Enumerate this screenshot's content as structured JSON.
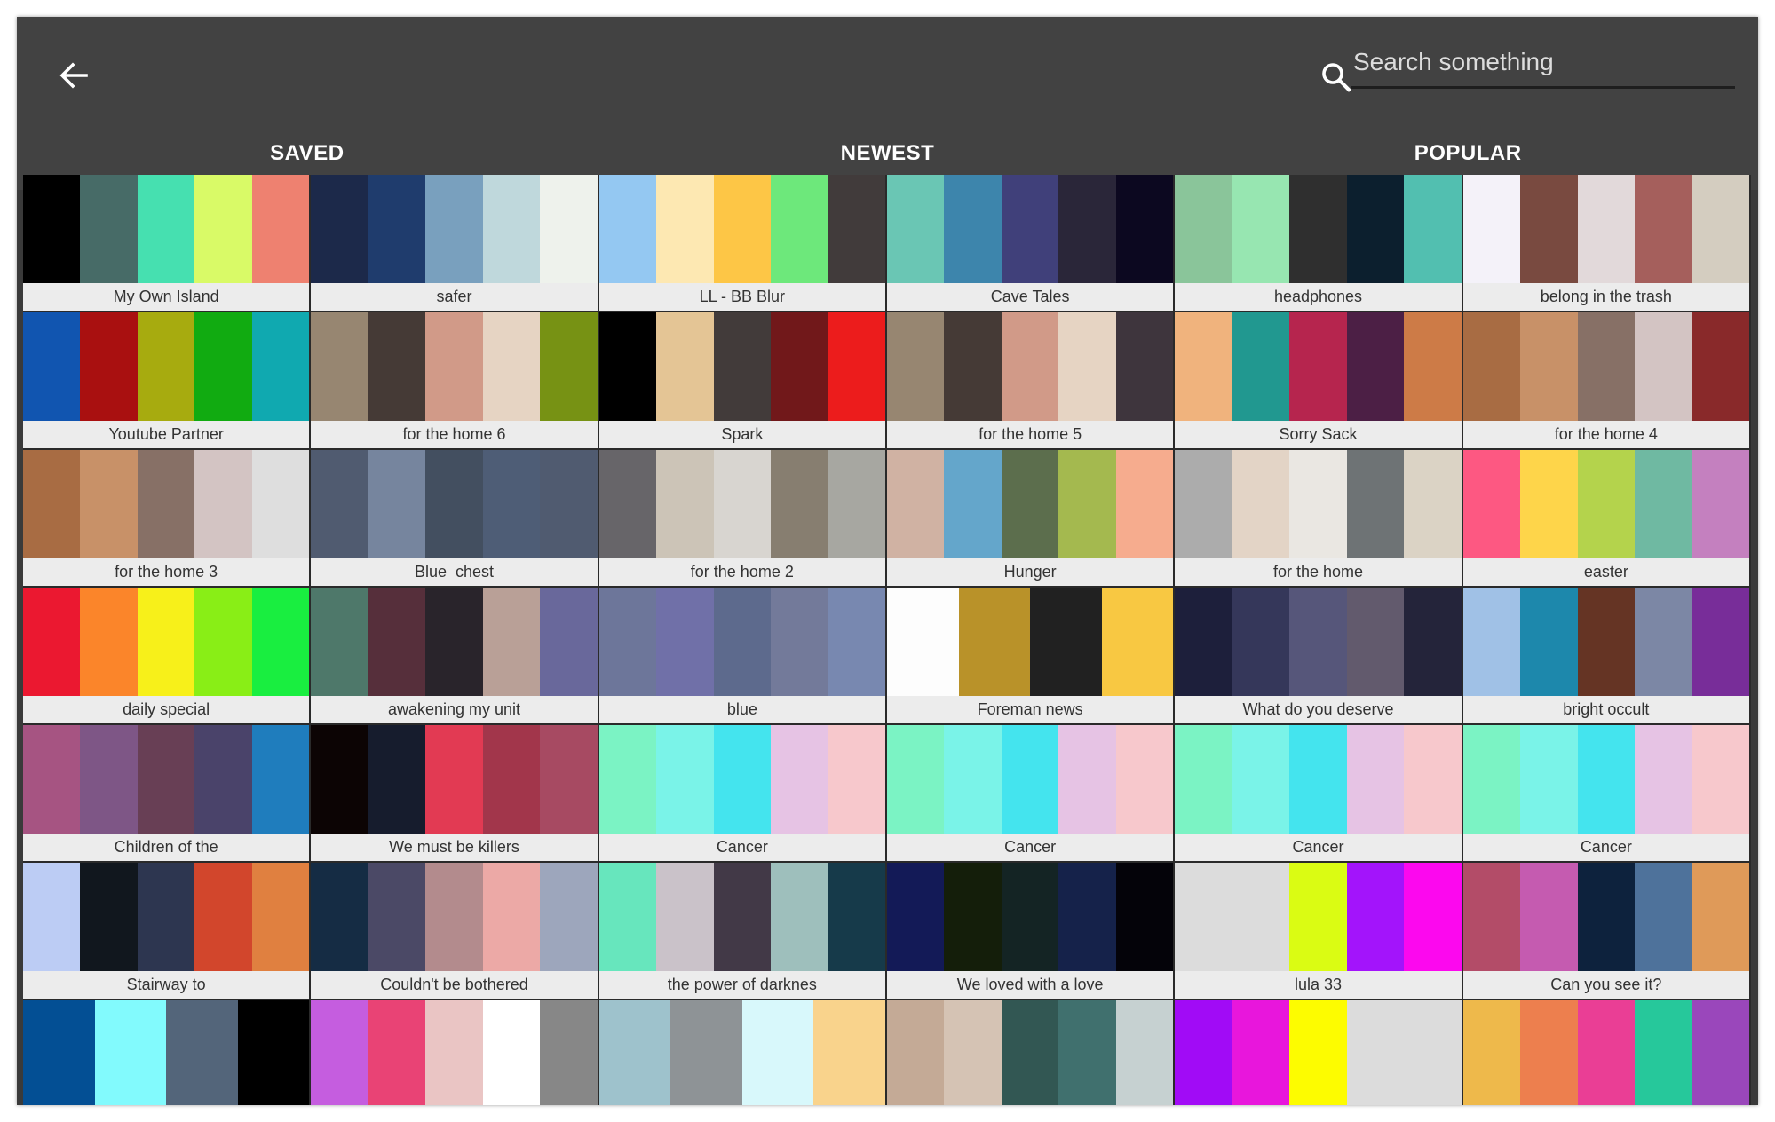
{
  "toolbar": {
    "search_placeholder": "Search something",
    "back_icon": "arrow-left-icon",
    "search_icon": "search-icon"
  },
  "tabs": [
    {
      "label": "SAVED",
      "active": false
    },
    {
      "label": "NEWEST",
      "active": true
    },
    {
      "label": "POPULAR",
      "active": false
    }
  ],
  "palettes": [
    {
      "name": "My Own Island",
      "colors": [
        "#000000",
        "#476b67",
        "#46e0b0",
        "#d9fa67",
        "#ee8170"
      ]
    },
    {
      "name": "safer",
      "colors": [
        "#1c294a",
        "#1f3c6d",
        "#79a0be",
        "#bfd8dc",
        "#eef2ec"
      ]
    },
    {
      "name": "LL - BB Blur",
      "colors": [
        "#94c8f2",
        "#fde8b2",
        "#fdc646",
        "#6de87b",
        "#413b3b"
      ]
    },
    {
      "name": "Cave Tales",
      "colors": [
        "#6ac6b4",
        "#3d85ac",
        "#40407a",
        "#2a2639",
        "#0c0820"
      ]
    },
    {
      "name": "headphones",
      "colors": [
        "#8ac59a",
        "#97e6b1",
        "#2f2f2f",
        "#0c1f2e",
        "#52bfb0"
      ]
    },
    {
      "name": "belong in the trash",
      "colors": [
        "#f4f2f9",
        "#794a40",
        "#e2d9da",
        "#a55f5c",
        "#d4cdc0"
      ]
    },
    {
      "name": "Youtube Partner",
      "colors": [
        "#1155b0",
        "#a91010",
        "#a7ab0f",
        "#11ab11",
        "#10a9b0"
      ]
    },
    {
      "name": "for the home 6",
      "colors": [
        "#978671",
        "#453a36",
        "#d19a88",
        "#e6d4c3",
        "#779214"
      ]
    },
    {
      "name": "Spark",
      "colors": [
        "#000000",
        "#e4c595",
        "#423b3a",
        "#71181a",
        "#ec1c1c"
      ]
    },
    {
      "name": "for the home 5",
      "colors": [
        "#978671",
        "#453a36",
        "#d19a88",
        "#e6d4c3",
        "#3e353d"
      ]
    },
    {
      "name": "Sorry Sack",
      "colors": [
        "#f0b37d",
        "#219890",
        "#b6254e",
        "#4c1f45",
        "#cd7b47"
      ]
    },
    {
      "name": "for the home 4",
      "colors": [
        "#a86c43",
        "#c89168",
        "#877066",
        "#d3c4c3",
        "#89292a"
      ]
    },
    {
      "name": "for the home 3",
      "colors": [
        "#a86c43",
        "#c89168",
        "#877066",
        "#d3c4c3",
        "#dedede"
      ]
    },
    {
      "name": "Blue  chest",
      "colors": [
        "#505b70",
        "#76859e",
        "#434f60",
        "#4e5d76",
        "#505b70"
      ]
    },
    {
      "name": "for the home 2",
      "colors": [
        "#676569",
        "#ccc4b7",
        "#d8d5d0",
        "#877e70",
        "#a7a7a1"
      ]
    },
    {
      "name": "Hunger",
      "colors": [
        "#d0b2a3",
        "#64a6cb",
        "#5c6e4d",
        "#a4b94f",
        "#f6ac8e"
      ]
    },
    {
      "name": "for the home",
      "colors": [
        "#acacac",
        "#e3d4c6",
        "#eae7e2",
        "#6e7375",
        "#dbd3c5"
      ]
    },
    {
      "name": "easter",
      "colors": [
        "#fd5882",
        "#fed54a",
        "#b4d34c",
        "#6fb9a2",
        "#c480bf"
      ]
    },
    {
      "name": "daily special",
      "colors": [
        "#eb1830",
        "#fb852a",
        "#f7f01a",
        "#89ee16",
        "#19ee40"
      ]
    },
    {
      "name": "awakening my unit",
      "colors": [
        "#4e786a",
        "#562f3b",
        "#29242b",
        "#b9a097",
        "#69689b"
      ]
    },
    {
      "name": "blue",
      "colors": [
        "#6d769a",
        "#7070a8",
        "#5d6a8d",
        "#737a9a",
        "#7888b0"
      ]
    },
    {
      "name": "Foreman news",
      "colors": [
        "#fdfdfd",
        "#b99229",
        "#212121",
        "#f8c842"
      ]
    },
    {
      "name": "What do you deserve",
      "colors": [
        "#1d1f3b",
        "#35375a",
        "#56567a",
        "#625a6d",
        "#24243a"
      ]
    },
    {
      "name": "bright occult",
      "colors": [
        "#a0c1e6",
        "#1d88ac",
        "#653424",
        "#7c87a5",
        "#782d99"
      ]
    },
    {
      "name": "Children of the",
      "colors": [
        "#a65482",
        "#7e5686",
        "#683f55",
        "#4a436a",
        "#1f7dbd"
      ]
    },
    {
      "name": "We must be killers",
      "colors": [
        "#0c0404",
        "#161c2d",
        "#e23a53",
        "#a2364b",
        "#a74a62"
      ]
    },
    {
      "name": "Cancer",
      "colors": [
        "#7bf3c4",
        "#7af3e8",
        "#44e4ee",
        "#e6c3e4",
        "#f7c8cc"
      ]
    },
    {
      "name": "Cancer",
      "colors": [
        "#7bf3c4",
        "#7af3e8",
        "#44e4ee",
        "#e6c3e4",
        "#f7c8cc"
      ]
    },
    {
      "name": "Cancer",
      "colors": [
        "#7bf3c4",
        "#7af3e8",
        "#44e4ee",
        "#e6c3e4",
        "#f7c8cc"
      ]
    },
    {
      "name": "Cancer",
      "colors": [
        "#7bf3c4",
        "#7af3e8",
        "#44e4ee",
        "#e6c3e4",
        "#f7c8cc"
      ]
    },
    {
      "name": "Stairway to",
      "colors": [
        "#bcccf4",
        "#11171e",
        "#2d3650",
        "#d2462c",
        "#e08040"
      ]
    },
    {
      "name": "Couldn't be bothered",
      "colors": [
        "#152c44",
        "#4b4966",
        "#b38b8d",
        "#eca9a6",
        "#9da6bc"
      ]
    },
    {
      "name": "the power of darknes",
      "colors": [
        "#67e6bd",
        "#cac2c9",
        "#423947",
        "#9ebfbc",
        "#163a4a"
      ]
    },
    {
      "name": "We loved with a love",
      "colors": [
        "#131a57",
        "#141e0a",
        "#142424",
        "#15224a",
        "#040309"
      ]
    },
    {
      "name": "lula 33",
      "colors": [
        "#dcdcdc",
        "#dcdcdc",
        "#dafc13",
        "#a314fb",
        "#fc08ee"
      ]
    },
    {
      "name": "Can you see it?",
      "colors": [
        "#b34c68",
        "#c55bb0",
        "#0d223d",
        "#4e729b",
        "#df9a59"
      ]
    },
    {
      "name": "",
      "colors": [
        "#034f94",
        "#82fafd",
        "#53657a",
        "#000000"
      ]
    },
    {
      "name": "",
      "colors": [
        "#c55ddf",
        "#e94375",
        "#eac5c4",
        "#ffffff",
        "#878787"
      ]
    },
    {
      "name": "",
      "colors": [
        "#9ec2cc",
        "#8e9396",
        "#d8f8fb",
        "#f9d38c"
      ]
    },
    {
      "name": "",
      "colors": [
        "#c4aa96",
        "#d5c3b4",
        "#325753",
        "#40706e",
        "#c6d1d1"
      ]
    },
    {
      "name": "",
      "colors": [
        "#a10bf6",
        "#e816dc",
        "#fdfc00",
        "#dcdcdc",
        "#dcdcdc"
      ]
    },
    {
      "name": "",
      "colors": [
        "#eeb94b",
        "#ed7f4e",
        "#ea3e95",
        "#26c89b",
        "#9a47bb"
      ]
    }
  ]
}
